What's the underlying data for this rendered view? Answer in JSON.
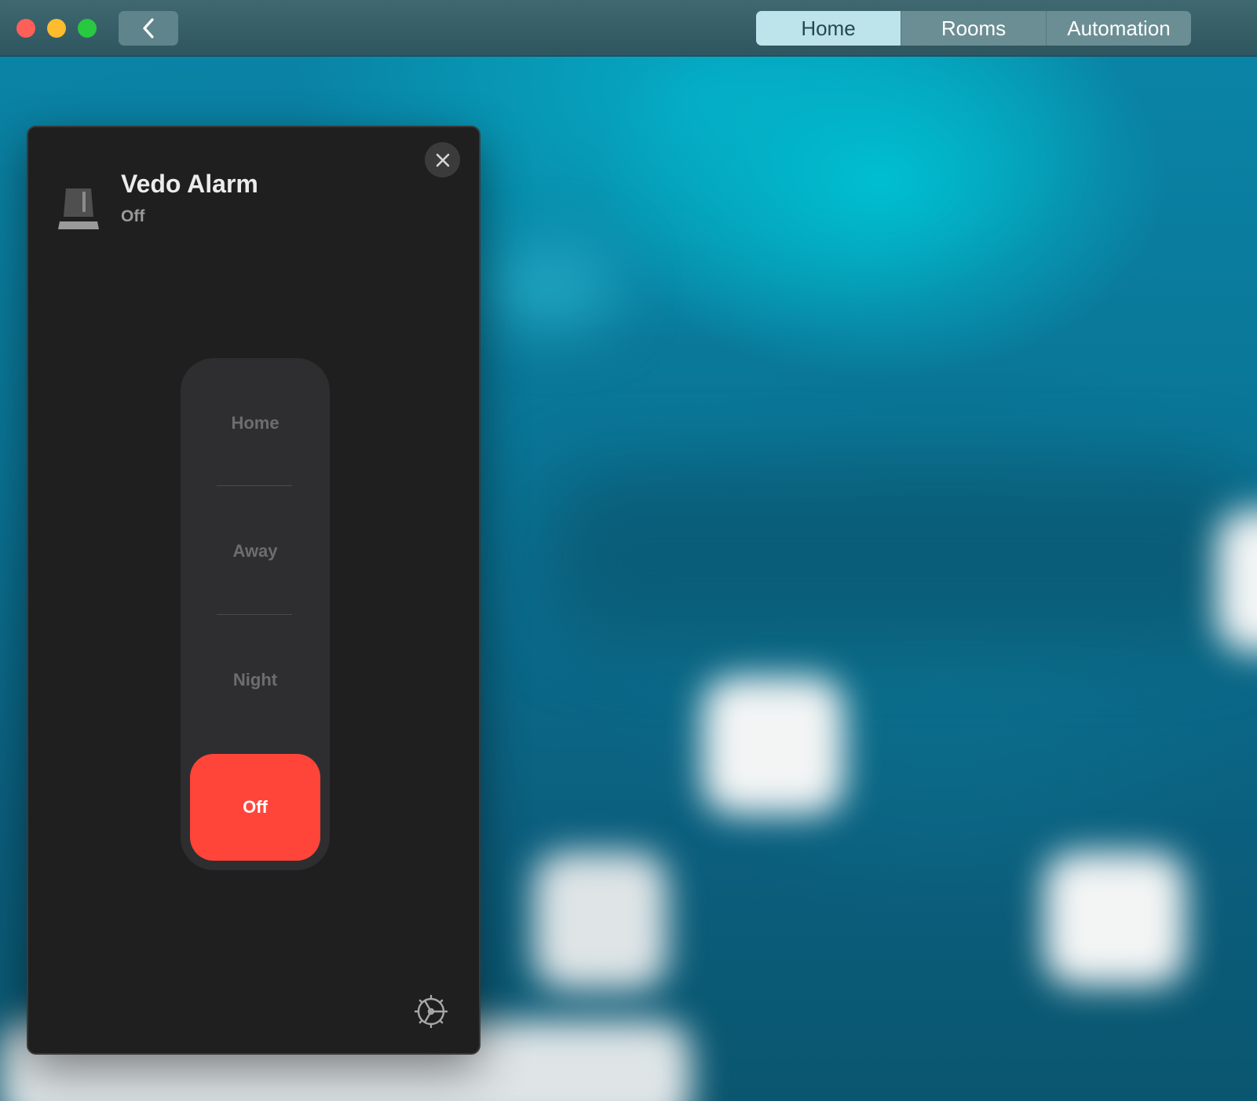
{
  "window": {
    "tabs": [
      {
        "label": "Home",
        "active": true
      },
      {
        "label": "Rooms",
        "active": false
      },
      {
        "label": "Automation",
        "active": false
      }
    ]
  },
  "dialog": {
    "device_name": "Vedo Alarm",
    "status": "Off",
    "modes": [
      {
        "label": "Home",
        "selected": false
      },
      {
        "label": "Away",
        "selected": false
      },
      {
        "label": "Night",
        "selected": false
      },
      {
        "label": "Off",
        "selected": true
      }
    ]
  },
  "icons": {
    "back": "chevron-left-icon",
    "close": "close-icon",
    "device": "alarm-siren-icon",
    "settings": "gear-icon"
  },
  "colors": {
    "accent_off": "#ff453a",
    "active_tab": "#bde4ea"
  }
}
